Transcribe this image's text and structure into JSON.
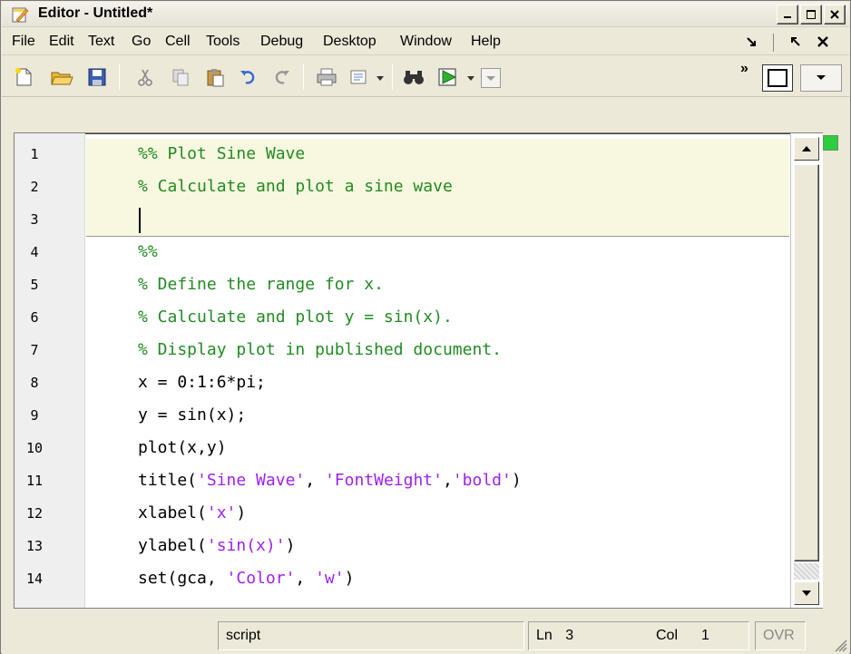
{
  "window": {
    "title": "Editor - Untitled*"
  },
  "menubar": {
    "items": [
      "File",
      "Edit",
      "Text",
      "Go",
      "Cell",
      "Tools",
      "Debug",
      "Desktop",
      "Window",
      "Help"
    ]
  },
  "toolbar": {
    "overflow_label": "»",
    "icons": [
      "new-file-icon",
      "open-folder-icon",
      "save-icon",
      "cut-icon",
      "copy-icon",
      "paste-icon",
      "undo-icon",
      "redo-icon",
      "print-icon",
      "publish-icon",
      "find-icon",
      "run-icon"
    ]
  },
  "editor": {
    "lines": [
      {
        "num": "1",
        "text": "%% Plot Sine Wave"
      },
      {
        "num": "2",
        "text": "% Calculate and plot a sine wave"
      },
      {
        "num": "3",
        "text": ""
      },
      {
        "num": "4",
        "text": "%%"
      },
      {
        "num": "5",
        "text": "% Define the range for x."
      },
      {
        "num": "6",
        "text": "% Calculate and plot y = sin(x)."
      },
      {
        "num": "7",
        "text": "% Display plot in published document."
      },
      {
        "num": "8",
        "text": "x = 0:1:6*pi;"
      },
      {
        "num": "9",
        "text": "y = sin(x);"
      },
      {
        "num": "10",
        "text": "plot(x,y)"
      },
      {
        "num": "11",
        "text": "title(",
        "s1": "'Sine Wave'",
        "t2": ", ",
        "s2": "'FontWeight'",
        "t3": ",",
        "s3": "'bold'",
        "t4": ")"
      },
      {
        "num": "12",
        "text": "xlabel(",
        "s1": "'x'",
        "t2": ")"
      },
      {
        "num": "13",
        "text": "ylabel(",
        "s1": "'sin(x)'",
        "t2": ")"
      },
      {
        "num": "14",
        "text": "set(gca, ",
        "s1": "'Color'",
        "t2": ", ",
        "s2": "'w'",
        "t3": ")"
      }
    ]
  },
  "statusbar": {
    "mode": "script",
    "ln_label": "Ln",
    "ln_value": "3",
    "col_label": "Col",
    "col_value": "1",
    "ovr": "OVR"
  },
  "colors": {
    "comment": "#228b22",
    "string": "#a020f0",
    "cell_highlight": "#f8f8e0"
  }
}
